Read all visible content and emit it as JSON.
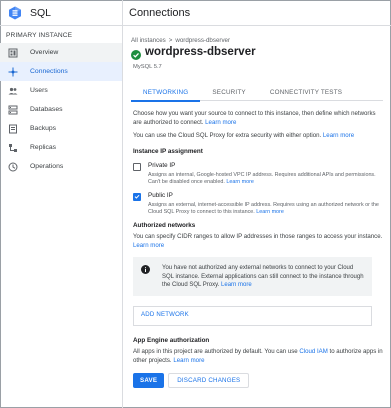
{
  "app": {
    "title": "SQL"
  },
  "header": {
    "title": "Connections"
  },
  "sidebar": {
    "heading": "PRIMARY INSTANCE",
    "items": [
      {
        "label": "Overview",
        "icon": "overview-icon"
      },
      {
        "label": "Connections",
        "icon": "connections-icon"
      },
      {
        "label": "Users",
        "icon": "users-icon"
      },
      {
        "label": "Databases",
        "icon": "databases-icon"
      },
      {
        "label": "Backups",
        "icon": "backups-icon"
      },
      {
        "label": "Replicas",
        "icon": "replicas-icon"
      },
      {
        "label": "Operations",
        "icon": "operations-icon"
      }
    ]
  },
  "breadcrumb": {
    "parent": "All instances",
    "separator": ">",
    "current": "wordpress-dbserver"
  },
  "instance": {
    "name": "wordpress-dbserver",
    "engine": "MySQL 5.7"
  },
  "tabs": [
    {
      "label": "NETWORKING"
    },
    {
      "label": "SECURITY"
    },
    {
      "label": "CONNECTIVITY TESTS"
    }
  ],
  "networking": {
    "intro": "Choose how you want your source to connect to this instance, then define which networks are authorized to connect.",
    "intro_link": "Learn more",
    "proxy": "You can use the Cloud SQL Proxy for extra security with either option.",
    "proxy_link": "Learn more",
    "ip_heading": "Instance IP assignment",
    "private_ip": {
      "label": "Private IP",
      "checked": false,
      "desc": "Assigns an internal, Google-hosted VPC IP address. Requires additional APIs and permissions. Can't be disabled once enabled.",
      "link": "Learn more"
    },
    "public_ip": {
      "label": "Public IP",
      "checked": true,
      "desc": "Assigns an external, internet-accessible IP address. Requires using an authorized network or the Cloud SQL Proxy to connect to this instance.",
      "link": "Learn more"
    },
    "auth_heading": "Authorized networks",
    "auth_desc": "You can specify CIDR ranges to allow IP addresses in those ranges to access your instance.",
    "auth_link": "Learn more",
    "info": "You have not authorized any external networks to connect to your Cloud SQL instance. External applications can still connect to the instance through the Cloud SQL Proxy.",
    "info_link": "Learn more",
    "add_network": "ADD NETWORK",
    "appengine_heading": "App Engine authorization",
    "appengine_desc": "All apps in this project are authorized by default. You can use",
    "appengine_link": "Cloud IAM",
    "appengine_desc2": "to authorize apps in other projects.",
    "appengine_link2": "Learn more"
  },
  "actions": {
    "save": "SAVE",
    "discard": "DISCARD CHANGES"
  },
  "colors": {
    "accent": "#1a73e8",
    "active_bg": "#e8f0fe",
    "logo": "#4285f4"
  }
}
